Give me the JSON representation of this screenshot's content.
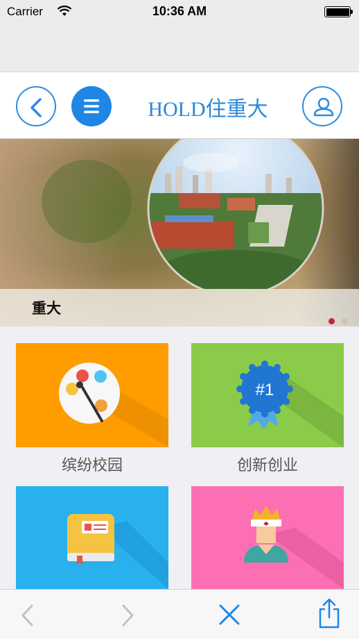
{
  "status_bar": {
    "carrier": "Carrier",
    "time": "10:36 AM",
    "icons": [
      "wifi-icon",
      "battery-icon"
    ]
  },
  "header": {
    "title": "HOLD住重大",
    "icons": [
      "back-icon",
      "menu-icon",
      "user-icon"
    ],
    "accent_color": "#2b8be0"
  },
  "banner": {
    "caption": "重大",
    "slides_total": 2,
    "active_slide": 1,
    "active_dot_color": "#c2283a"
  },
  "tiles": [
    {
      "label": "缤纷校园",
      "icon": "palette-icon",
      "color": "#ff9c00"
    },
    {
      "label": "创新创业",
      "icon": "award-badge-icon",
      "badge_text": "#1",
      "color": "#8bcb4a"
    },
    {
      "label": "",
      "icon": "book-icon",
      "color": "#29b1ee"
    },
    {
      "label": "",
      "icon": "king-icon",
      "color": "#fd6fb3"
    }
  ],
  "toolbar": {
    "icons": [
      "back-arrow-icon",
      "forward-arrow-icon",
      "close-icon",
      "share-icon"
    ],
    "accent_color": "#1f86e6"
  }
}
